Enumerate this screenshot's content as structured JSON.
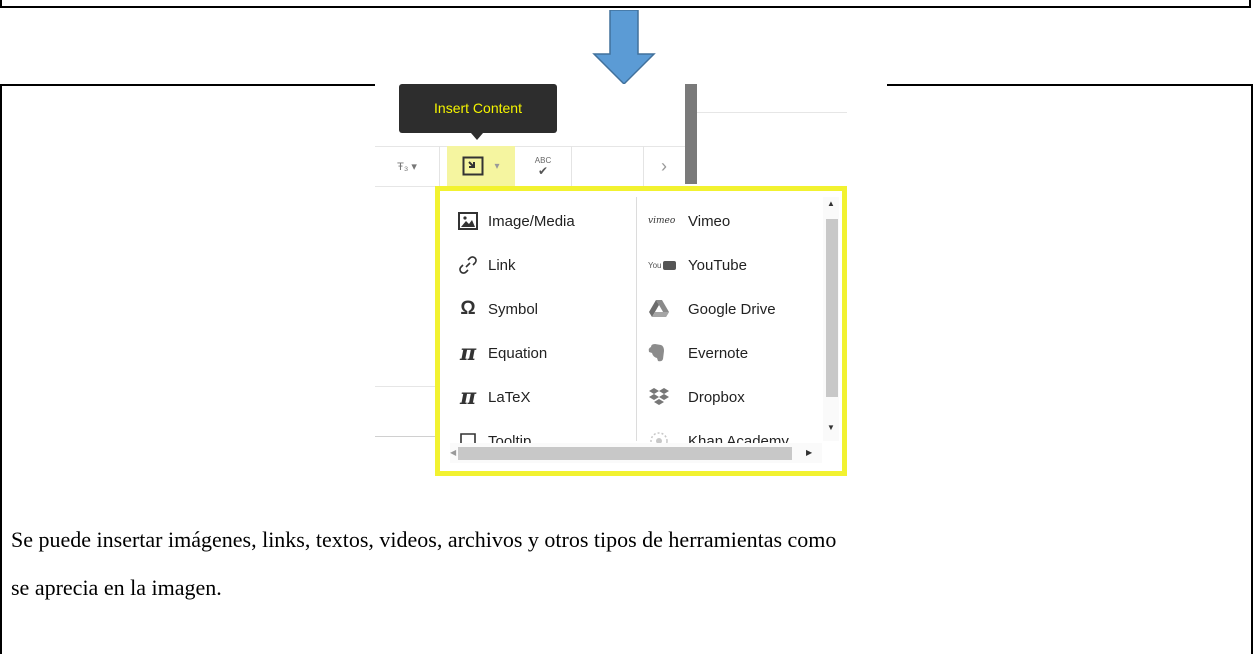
{
  "tooltip": {
    "label": "Insert Content"
  },
  "toolbar": {
    "subscript_glyph": "Ŧ₃ ▾",
    "insert_caret": "▾",
    "spellcheck_text": "ABC",
    "more_chevron": "›"
  },
  "menu": {
    "left_items": [
      {
        "label": "Image/Media",
        "icon": "image-icon"
      },
      {
        "label": "Link",
        "icon": "link-icon"
      },
      {
        "label": "Symbol",
        "icon": "omega-icon",
        "glyph": "Ω"
      },
      {
        "label": "Equation",
        "icon": "pi-icon",
        "glyph": "π"
      },
      {
        "label": "LaTeX",
        "icon": "pi-icon",
        "glyph": "π"
      },
      {
        "label": "Tooltip",
        "icon": "speech-bubble-icon"
      }
    ],
    "right_items": [
      {
        "label": "Vimeo",
        "icon": "vimeo-icon",
        "glyph": "vimeo"
      },
      {
        "label": "YouTube",
        "icon": "youtube-icon",
        "glyph": "You"
      },
      {
        "label": "Google Drive",
        "icon": "google-drive-icon"
      },
      {
        "label": "Evernote",
        "icon": "evernote-icon"
      },
      {
        "label": "Dropbox",
        "icon": "dropbox-icon"
      },
      {
        "label": "Khan Academy",
        "icon": "khan-academy-icon"
      }
    ]
  },
  "caption": {
    "line1": "Se puede insertar imágenes, links, textos, videos, archivos y otros tipos de herramientas como",
    "line2": "se aprecia en la imagen."
  },
  "colors": {
    "highlight": "#f2f230",
    "tooltip_bg": "#2d2d2d",
    "tooltip_text": "#f5f500",
    "arrow": "#5b9bd5"
  }
}
